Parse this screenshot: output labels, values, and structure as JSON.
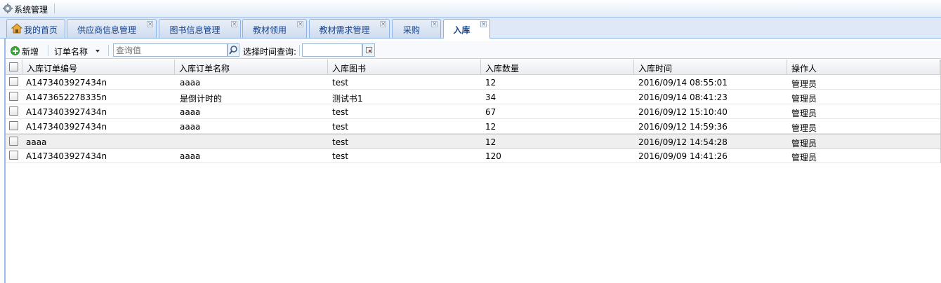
{
  "titlebar": {
    "title": "系统管理",
    "icon": "gear-icon"
  },
  "tabs": [
    {
      "label": "我的首页",
      "icon": "home-icon",
      "closable": false,
      "active": false
    },
    {
      "label": "供应商信息管理",
      "closable": true,
      "active": false
    },
    {
      "label": "图书信息管理",
      "closable": true,
      "active": false
    },
    {
      "label": "教材领用",
      "closable": true,
      "active": false
    },
    {
      "label": "教材需求管理",
      "closable": true,
      "active": false
    },
    {
      "label": "采购",
      "closable": true,
      "active": false
    },
    {
      "label": "入库",
      "closable": true,
      "active": true
    }
  ],
  "toolbar": {
    "add_label": "新增",
    "field_select": "订单名称",
    "search_placeholder": "查询值",
    "date_label": "选择时间查询:",
    "date_value": ""
  },
  "grid": {
    "columns": [
      "入库订单编号",
      "入库订单名称",
      "入库图书",
      "入库数量",
      "入库时间",
      "操作人"
    ],
    "rows": [
      [
        "A1473403927434n",
        "aaaa",
        "test",
        "12",
        "2016/09/14 08:55:01",
        "管理员"
      ],
      [
        "A1473652278335n",
        "是倒计时的",
        "测试书1",
        "34",
        "2016/09/14 08:41:23",
        "管理员"
      ],
      [
        "A1473403927434n",
        "aaaa",
        "test",
        "67",
        "2016/09/12 15:10:40",
        "管理员"
      ],
      [
        "A1473403927434n",
        "aaaa",
        "test",
        "12",
        "2016/09/12 14:59:36",
        "管理员"
      ],
      [
        "aaaa",
        "",
        "test",
        "12",
        "2016/09/12 14:54:28",
        "管理员"
      ],
      [
        "A1473403927434n",
        "aaaa",
        "test",
        "120",
        "2016/09/09 14:41:26",
        "管理员"
      ]
    ]
  }
}
